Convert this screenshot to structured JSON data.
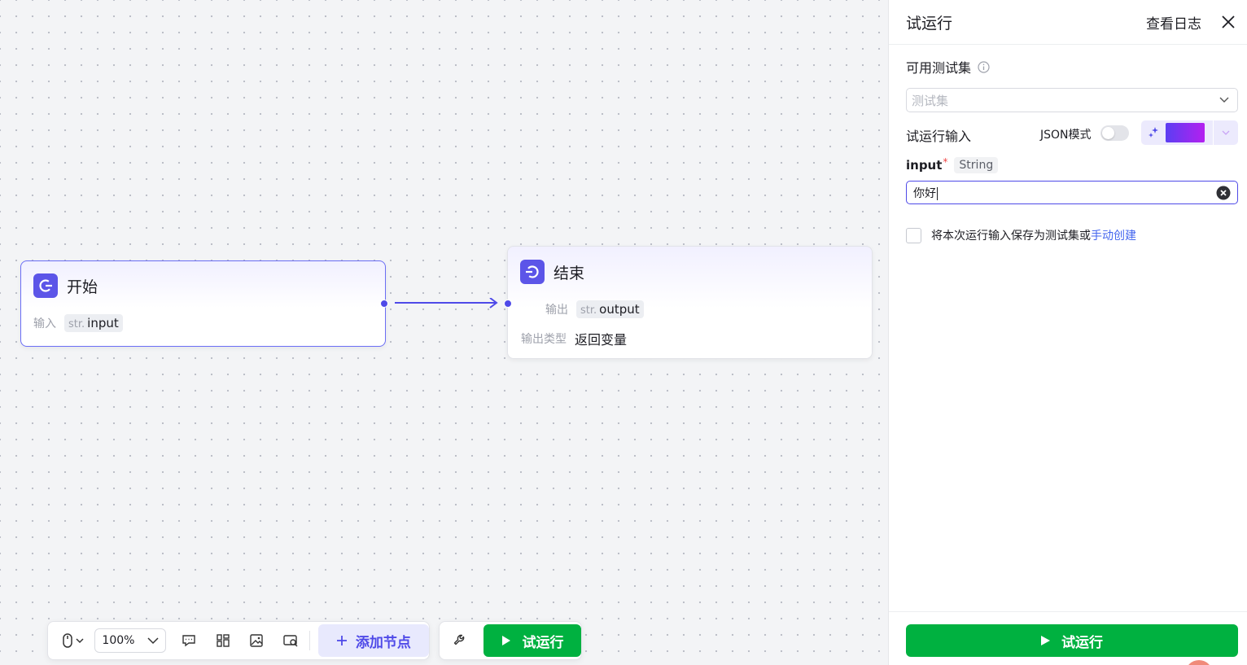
{
  "canvas": {
    "start_node": {
      "title": "开始",
      "input_label": "输入",
      "var_type": "str.",
      "var_name": "input"
    },
    "end_node": {
      "title": "结束",
      "output_label": "输出",
      "var_type": "str.",
      "var_name": "output",
      "output_type_label": "输出类型",
      "output_type_value": "返回变量"
    }
  },
  "toolbar": {
    "zoom": "100%",
    "add_node_label": "添加节点",
    "run_label": "试运行",
    "icons": [
      "mouse-icon",
      "comment-icon",
      "layout-icon",
      "image-icon",
      "minimap-icon",
      "wrench-icon"
    ]
  },
  "panel": {
    "title": "试运行",
    "view_log": "查看日志",
    "test_set_label": "可用测试集",
    "test_set_placeholder": "测试集",
    "run_input_label": "试运行输入",
    "json_mode_label": "JSON模式",
    "json_mode_on": false,
    "field": {
      "name": "input",
      "required_mark": "*",
      "type": "String",
      "value": "你好"
    },
    "save_text": "将本次运行输入保存为测试集或",
    "manual_create_link": "手动创建",
    "run_button": "试运行"
  },
  "colors": {
    "accent": "#4f4ae8",
    "run_green": "#00b140",
    "link": "#4466ee"
  }
}
